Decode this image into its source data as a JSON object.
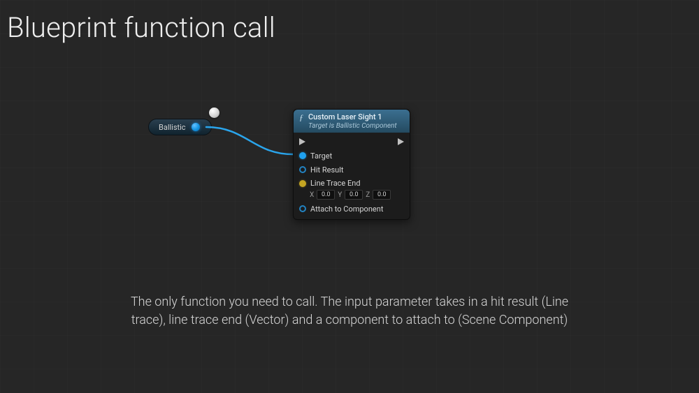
{
  "title": "Blueprint function call",
  "variable_pill": {
    "label": "Ballistic"
  },
  "node": {
    "header": {
      "title": "Custom Laser Sight 1",
      "subtitle": "Target is Ballistic Component"
    },
    "pins": {
      "target": "Target",
      "hit_result": "Hit Result",
      "line_trace_end": {
        "label": "Line Trace End",
        "x_label": "X",
        "y_label": "Y",
        "z_label": "Z",
        "x": "0.0",
        "y": "0.0",
        "z": "0.0"
      },
      "attach": "Attach to Component"
    }
  },
  "caption": "The only function you need to call. The input parameter takes in a hit result (Line trace), line trace end (Vector) and a component to attach to (Scene Component)"
}
